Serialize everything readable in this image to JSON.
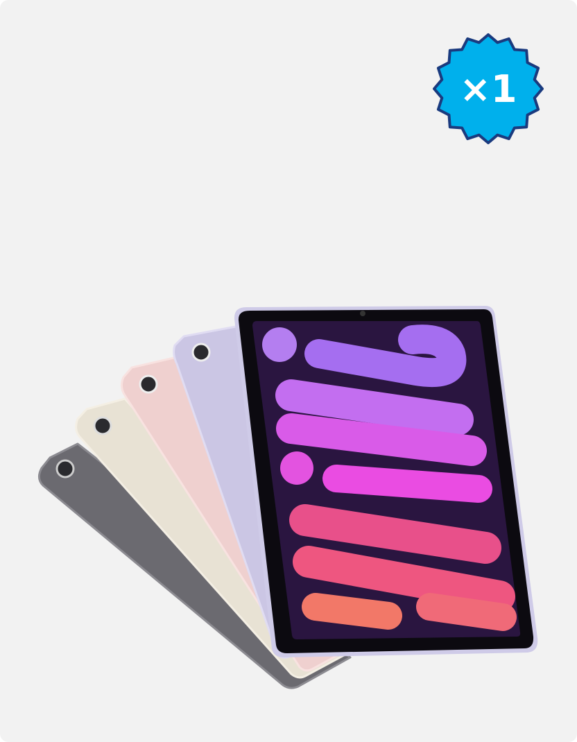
{
  "badge": {
    "label": "×1",
    "fill": "#00b0ec",
    "stroke": "#1a3a7e"
  },
  "product": {
    "colors": [
      "#6e6d73",
      "#e9e3d5",
      "#f0d3d1",
      "#cfcbe6",
      "#d6d2ee"
    ]
  }
}
